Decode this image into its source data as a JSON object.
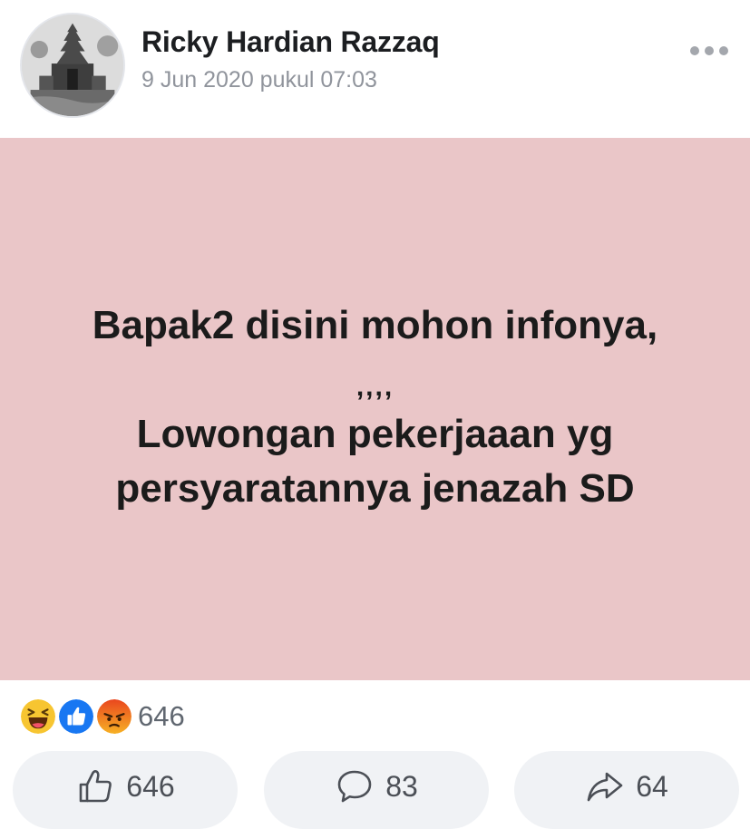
{
  "post": {
    "author": "Ricky Hardian Razzaq",
    "timestamp": "9 Jun 2020 pukul 07:03",
    "more_icon": "more-horizontal-icon",
    "background_color": "#eac6c8",
    "text_lines": [
      "Bapak2 disini mohon infonya,",
      ",,,,",
      "Lowongan pekerjaaan yg",
      "persyaratannya jenazah SD"
    ]
  },
  "reactions": {
    "icons": [
      "haha-reaction-icon",
      "like-reaction-icon",
      "angry-reaction-icon"
    ],
    "total": "646"
  },
  "actions": {
    "like": {
      "icon": "thumbs-up-icon",
      "count": "646"
    },
    "comment": {
      "icon": "comment-bubble-icon",
      "count": "83"
    },
    "share": {
      "icon": "share-arrow-icon",
      "count": "64"
    }
  }
}
